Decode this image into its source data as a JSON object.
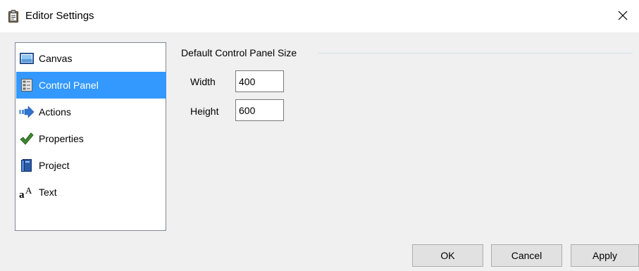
{
  "window": {
    "title": "Editor Settings",
    "title_icon": "clipboard-document-icon",
    "close_glyph": "✕"
  },
  "sidebar": {
    "selected_index": 1,
    "selected_color": "#3399ff",
    "items": [
      {
        "label": "Canvas",
        "icon": "canvas-icon"
      },
      {
        "label": "Control Panel",
        "icon": "control-panel-icon"
      },
      {
        "label": "Actions",
        "icon": "arrow-right-icon"
      },
      {
        "label": "Properties",
        "icon": "checkmark-icon"
      },
      {
        "label": "Project",
        "icon": "book-icon"
      },
      {
        "label": "Text",
        "icon": "text-font-icon"
      }
    ]
  },
  "panel": {
    "group_title": "Default Control Panel Size",
    "width": {
      "label": "Width",
      "value": "400"
    },
    "height": {
      "label": "Height",
      "value": "600"
    }
  },
  "buttons": {
    "ok": "OK",
    "cancel": "Cancel",
    "apply": "Apply"
  }
}
